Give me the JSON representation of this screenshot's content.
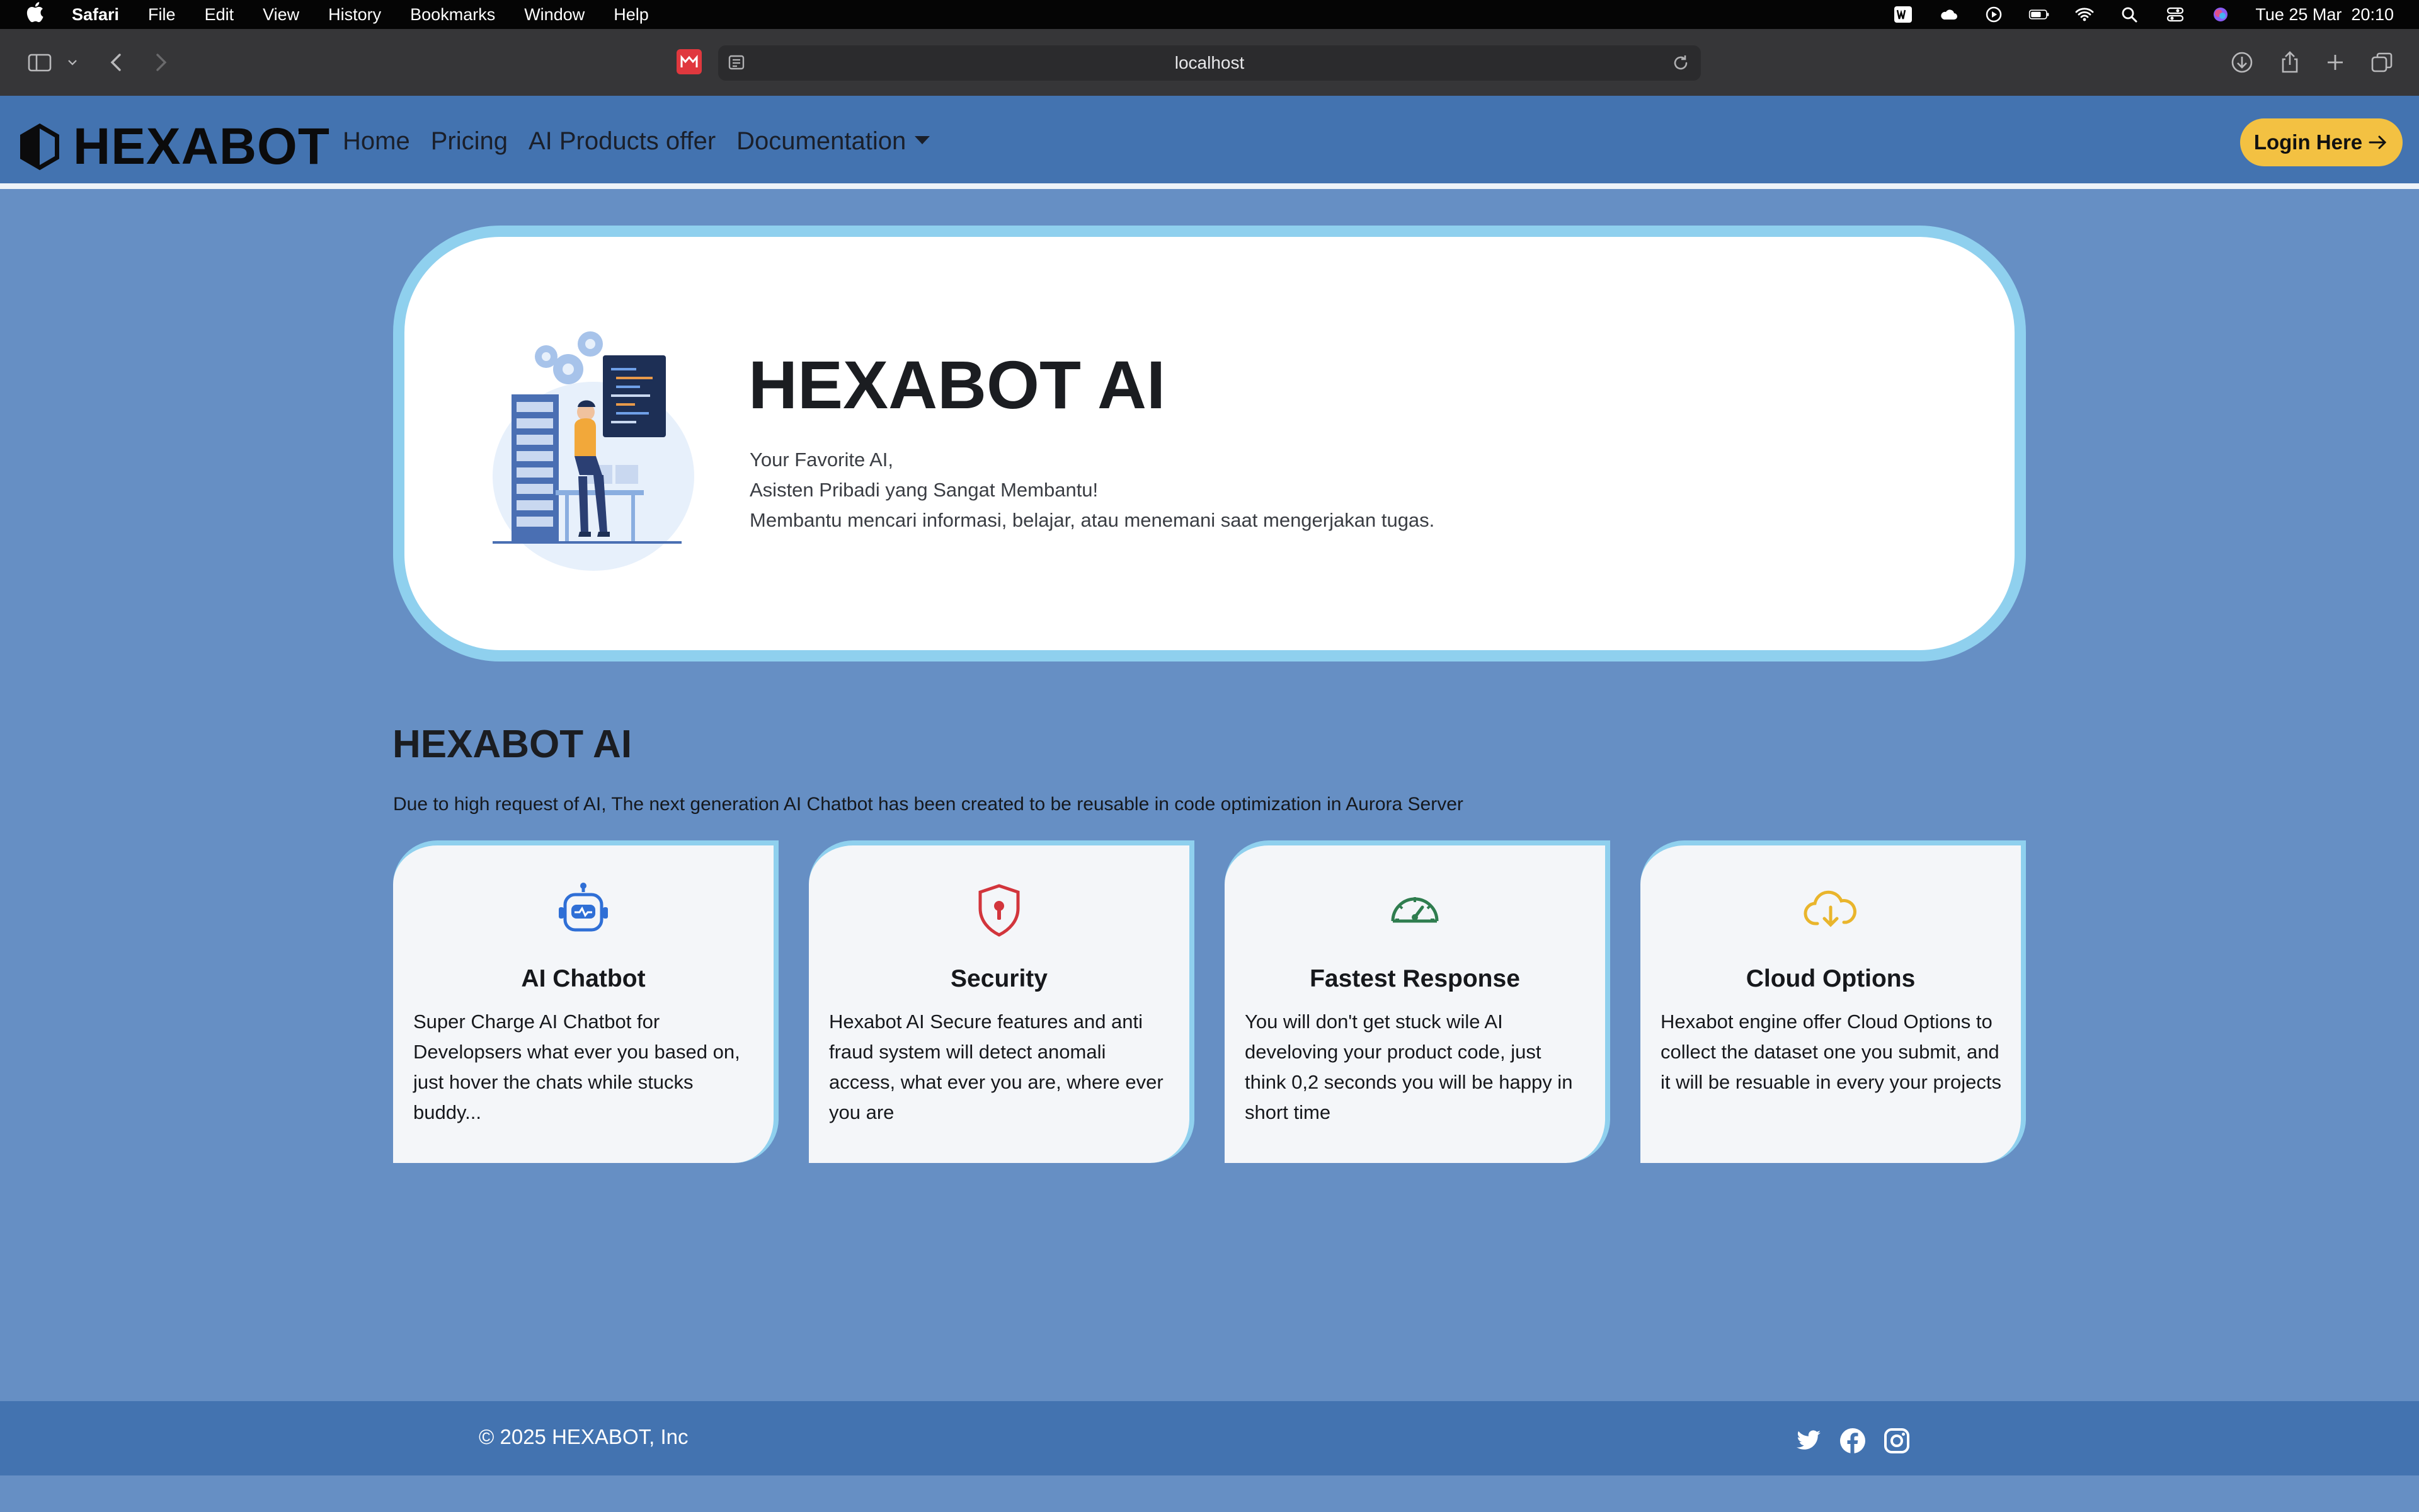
{
  "menubar": {
    "app_name": "Safari",
    "menus": [
      "File",
      "Edit",
      "View",
      "History",
      "Bookmarks",
      "Window",
      "Help"
    ],
    "clock": "Tue 25 Mar  20:10"
  },
  "browser": {
    "url": "localhost"
  },
  "navbar": {
    "brand": "HEXABOT",
    "links": [
      "Home",
      "Pricing",
      "AI Products offer",
      "Documentation"
    ],
    "login_label": "Login Here"
  },
  "hero": {
    "title": "HEXABOT AI",
    "lines": [
      "Your Favorite AI,",
      "Asisten Pribadi yang Sangat Membantu!",
      "Membantu mencari informasi, belajar, atau menemani saat mengerjakan tugas."
    ]
  },
  "section": {
    "title": "HEXABOT AI",
    "description": "Due to high request of AI, The next generation AI Chatbot has been created to be reusable in code optimization in Aurora Server"
  },
  "cards": [
    {
      "title": "AI Chatbot",
      "text": "Super Charge AI Chatbot for Developsers what ever you based on, just hover the chats while stucks buddy...",
      "icon": "robot-icon",
      "icon_color": "#2f6fd6"
    },
    {
      "title": "Security",
      "text": "Hexabot AI Secure features and anti fraud system will detect anomali access, what ever you are, where ever you are",
      "icon": "shield-lock-icon",
      "icon_color": "#d2353c"
    },
    {
      "title": "Fastest Response",
      "text": "You will don't get stuck wile AI develoving your product code, just think 0,2 seconds you will be happy in short time",
      "icon": "speedometer-icon",
      "icon_color": "#2f7d4f"
    },
    {
      "title": "Cloud Options",
      "text": "Hexabot engine offer Cloud Options to collect the dataset one you submit, and it will be resuable in every your projects",
      "icon": "cloud-download-icon",
      "icon_color": "#e9b52c"
    }
  ],
  "footer": {
    "copyright": "© 2025 HEXABOT, Inc",
    "socials": [
      "twitter-icon",
      "facebook-icon",
      "instagram-icon"
    ]
  },
  "colors": {
    "page_bg": "#668fc4",
    "navbar_bg": "#4373b0",
    "accent_border": "#8fd0ee",
    "login_button": "#f3c142"
  }
}
